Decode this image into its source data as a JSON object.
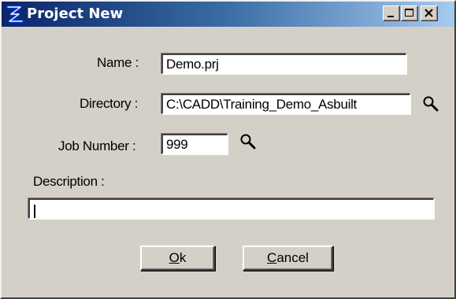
{
  "window": {
    "title": "Project New",
    "title_bg_start": "#0a246a",
    "title_bg_end": "#a6caf0",
    "face_color": "#d4d0c8"
  },
  "title_buttons": {
    "minimize_icon": "minimize-icon",
    "maximize_icon": "maximize-icon",
    "close_icon": "close-icon"
  },
  "form": {
    "name_label": "Name :",
    "name_value": "Demo.prj",
    "directory_label": "Directory :",
    "directory_value": "C:\\CADD\\Training_Demo_Asbuilt",
    "job_number_label": "Job Number :",
    "job_number_value": "999",
    "description_label": "Description :",
    "description_value": ""
  },
  "buttons": {
    "ok_mnemonic": "O",
    "ok_rest": "k",
    "cancel_mnemonic": "C",
    "cancel_rest": "ancel"
  }
}
